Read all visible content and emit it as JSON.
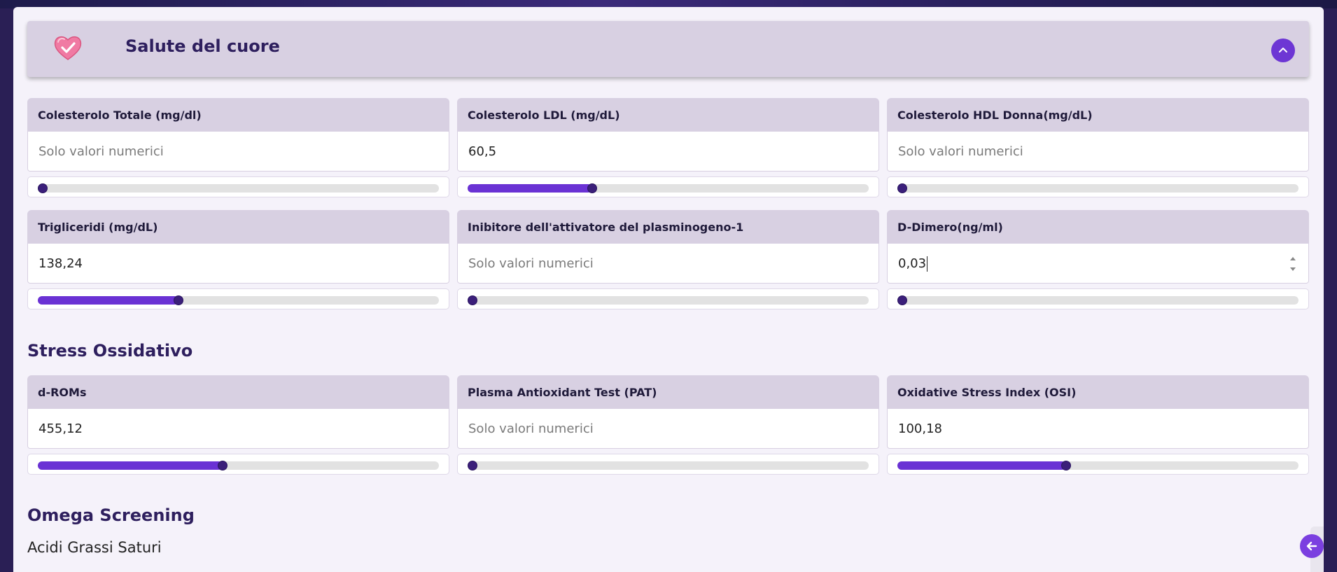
{
  "header": {
    "title": "Salute del cuore",
    "icon": "heart-check-icon",
    "collapse_icon": "chevron-up-icon"
  },
  "colors": {
    "accent": "#6a32d4",
    "header_bg": "#d8d0e2",
    "page_bg": "#f5f2fa",
    "title": "#2e1f5e"
  },
  "cuore_fields": [
    {
      "label": "Colesterolo Totale (mg/dl)",
      "value": "",
      "placeholder": "Solo valori numerici",
      "slider": 0.0
    },
    {
      "label": "Colesterolo LDL (mg/dL)",
      "value": "60,5",
      "placeholder": "Solo valori numerici",
      "slider": 0.31
    },
    {
      "label": "Colesterolo HDL Donna(mg/dL)",
      "value": "",
      "placeholder": "Solo valori numerici",
      "slider": 0.0
    },
    {
      "label": "Trigliceridi (mg/dL)",
      "value": "138,24",
      "placeholder": "Solo valori numerici",
      "slider": 0.35
    },
    {
      "label": "Inibitore dell'attivatore del plasminogeno-1",
      "value": "",
      "placeholder": "Solo valori numerici",
      "slider": 0.0
    },
    {
      "label": "D-Dimero(ng/ml)",
      "value": "0,03",
      "placeholder": "Solo valori numerici",
      "slider": 0.0
    }
  ],
  "stress": {
    "title": "Stress Ossidativo",
    "fields": [
      {
        "label": "d-ROMs",
        "value": "455,12",
        "placeholder": "Solo valori numerici",
        "slider": 0.46
      },
      {
        "label": "Plasma Antioxidant Test (PAT)",
        "value": "",
        "placeholder": "Solo valori numerici",
        "slider": 0.0
      },
      {
        "label": "Oxidative Stress Index (OSI)",
        "value": "100,18",
        "placeholder": "Solo valori numerici",
        "slider": 0.42
      }
    ]
  },
  "omega": {
    "title": "Omega Screening",
    "subtitle": "Acidi Grassi Saturi"
  },
  "fab_icon": "arrow-left-icon"
}
